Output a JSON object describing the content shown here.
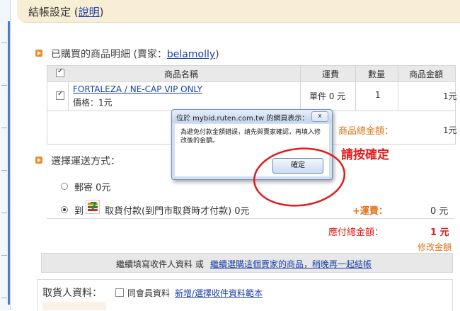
{
  "header": {
    "title": "結帳設定",
    "help_link": "說明"
  },
  "purchase_section": {
    "title": "已購買的商品明細 (賣家：",
    "seller": "belamolly",
    "title_suffix": ")"
  },
  "table": {
    "columns": [
      "商品名稱",
      "運費",
      "數量",
      "商品金額"
    ],
    "rows": [
      {
        "name": "FORTALEZA / NE-CAP VIP ONLY",
        "price_text": "價格：1元",
        "shipping": "單件 0 元",
        "qty": "1",
        "amount": "1元"
      }
    ],
    "subtotal_label": "商品總金額：",
    "subtotal_value": "1元"
  },
  "shipping_section": {
    "title": "選擇運送方式：",
    "options": [
      {
        "label": "郵寄 0元",
        "selected": false
      },
      {
        "label_prefix": "到",
        "label": "取貨付款(到門市取貨時才付款) 0元",
        "selected": true
      }
    ],
    "fee_label": "+運費：",
    "fee_value": "0 元",
    "total_label": "應付總金額：",
    "total_value": "1 元",
    "edit_link": "修改金額"
  },
  "continue_bar": {
    "text": "繼續填寫收件人資料 或",
    "link": "繼續選購這個賣家的商品，稍晚再一起結帳"
  },
  "recipient": {
    "label": "取貨人資料：",
    "same_member": "同會員資料",
    "template_link": "新增/選擇收件資料範本"
  },
  "dialog": {
    "title": "位於 mybid.ruten.com.tw 的網頁表示：",
    "close": "x",
    "message": "為避免付款金額錯誤，請先與賣家確認，再填入修改後的金額。",
    "ok": "確定"
  },
  "annotation": "請按確定",
  "colors": {
    "accent_orange": "#e2741a",
    "red": "#e21b1b",
    "link": "#1a3fa8",
    "header_bg": "#f7eed5"
  }
}
